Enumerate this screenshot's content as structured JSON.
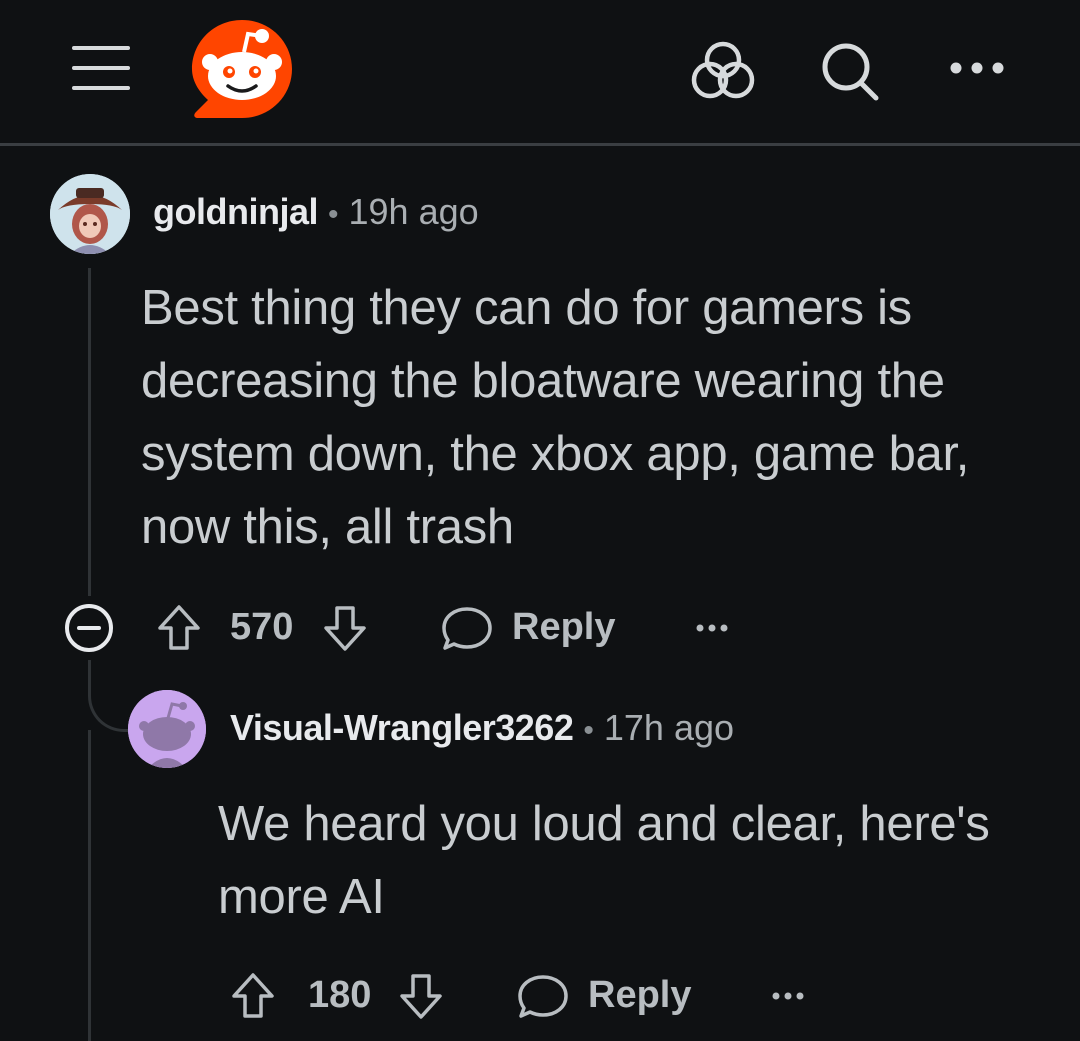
{
  "header": {
    "menu_icon": "hamburger-menu-icon",
    "logo_icon": "reddit-logo-icon",
    "communities_icon": "communities-icon",
    "search_icon": "search-icon",
    "more_icon": "more-options-icon"
  },
  "comments": [
    {
      "author": "goldninjal",
      "separator": "•",
      "time": "19h ago",
      "body": "Best thing they can do for gamers is decreasing the bloatware wearing the system down, the xbox app, game bar, now this, all trash",
      "score": "570",
      "reply_label": "Reply"
    },
    {
      "author": "Visual-Wrangler3262",
      "separator": "•",
      "time": "17h ago",
      "body": "We heard you loud and clear, here's more AI",
      "score": "180",
      "reply_label": "Reply"
    }
  ],
  "colors": {
    "background": "#0f1113",
    "brand": "#ff4500",
    "text": "#c9cdd0",
    "muted": "#a9aeb2"
  }
}
